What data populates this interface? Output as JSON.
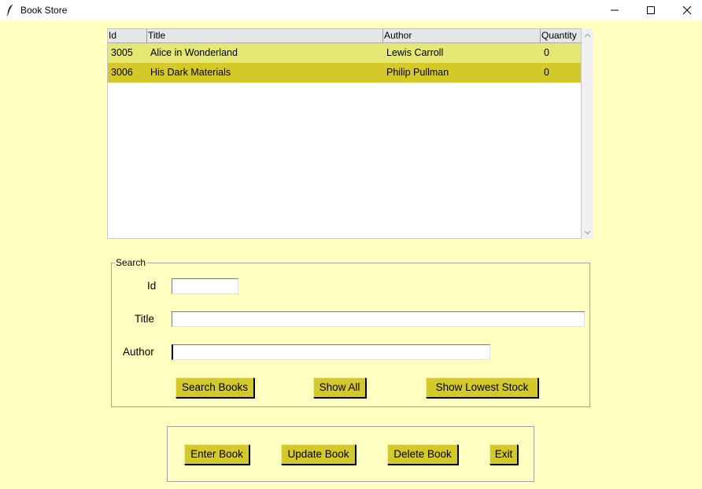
{
  "window": {
    "title": "Book Store",
    "icon": "feather-icon",
    "controls": [
      "minimize-icon",
      "maximize-icon",
      "close-icon"
    ]
  },
  "table": {
    "columns": [
      "Id",
      "Title",
      "Author",
      "Quantity"
    ],
    "rows": [
      {
        "id": "3005",
        "title": "Alice in Wonderland",
        "author": "Lewis Carroll",
        "quantity": "0"
      },
      {
        "id": "3006",
        "title": "His Dark Materials",
        "author": "Philip Pullman",
        "quantity": "0"
      }
    ],
    "row_colors": [
      "#e5e773",
      "#d5c92a"
    ]
  },
  "search": {
    "legend": "Search",
    "id_label": "Id",
    "id_value": "",
    "title_label": "Title",
    "title_value": "",
    "author_label": "Author",
    "author_value": "",
    "search_button": "Search Books",
    "show_all_button": "Show All",
    "lowest_stock_button": "Show Lowest Stock"
  },
  "actions": {
    "enter_button": "Enter Book",
    "update_button": "Update Book",
    "delete_button": "Delete Book",
    "exit_button": "Exit"
  },
  "colors": {
    "background": "#ffffc0",
    "button": "#d4c92a"
  }
}
